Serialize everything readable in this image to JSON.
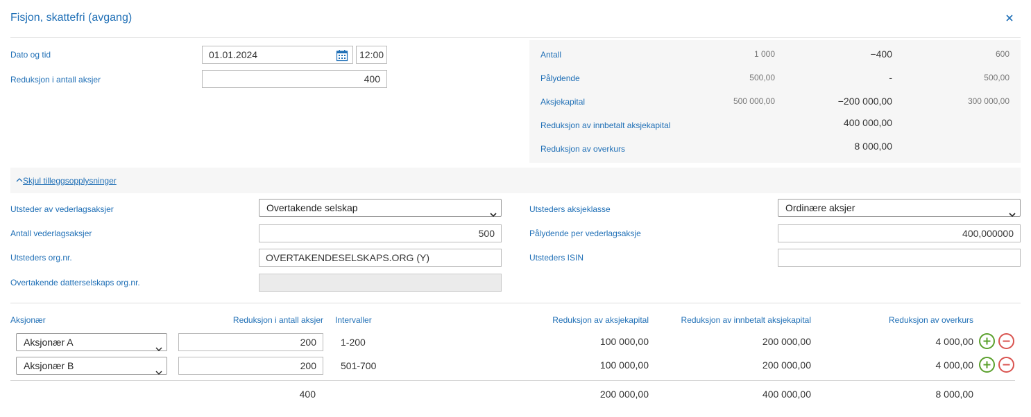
{
  "dialog": {
    "title": "Fisjon, skattefri (avgang)",
    "close_icon": "close-icon"
  },
  "form": {
    "date_label": "Dato og tid",
    "date_value": "01.01.2024",
    "time_value": "12:00",
    "reduction_label": "Reduksjon i antall aksjer",
    "reduction_value": "400"
  },
  "summary": {
    "rows": [
      {
        "label": "Antall",
        "before": "1 000",
        "change": "−400",
        "after": "600"
      },
      {
        "label": "Pålydende",
        "before": "500,00",
        "change": "-",
        "after": "500,00"
      },
      {
        "label": "Aksjekapital",
        "before": "500 000,00",
        "change": "−200 000,00",
        "after": "300 000,00"
      },
      {
        "label": "Reduksjon av innbetalt aksjekapital",
        "before": "",
        "change": "400 000,00",
        "after": ""
      },
      {
        "label": "Reduksjon av overkurs",
        "before": "",
        "change": "8 000,00",
        "after": ""
      }
    ]
  },
  "extra": {
    "toggle_label": "Skjul tilleggsopplysninger",
    "issuer_label": "Utsteder av vederlagsaksjer",
    "issuer_value": "Overtakende selskap",
    "count_label": "Antall vederlagsaksjer",
    "count_value": "500",
    "orgnr_label": "Utsteders org.nr.",
    "orgnr_value": "OVERTAKENDESELSKAPS.ORG (Y)",
    "sub_orgnr_label": "Overtakende datterselskaps org.nr.",
    "sub_orgnr_value": "",
    "class_label": "Utsteders aksjeklasse",
    "class_value": "Ordinære aksjer",
    "nominal_label": "Pålydende per vederlagsaksje",
    "nominal_value": "400,000000",
    "isin_label": "Utsteders ISIN",
    "isin_value": ""
  },
  "table": {
    "headers": {
      "shareholder": "Aksjonær",
      "reduction": "Reduksjon i antall aksjer",
      "intervals": "Intervaller",
      "capital": "Reduksjon av aksjekapital",
      "paid_in": "Reduksjon av innbetalt aksjekapital",
      "premium": "Reduksjon av overkurs"
    },
    "rows": [
      {
        "shareholder": "Aksjonær A",
        "reduction": "200",
        "intervals": "1-200",
        "capital": "100 000,00",
        "paid_in": "200 000,00",
        "premium": "4 000,00"
      },
      {
        "shareholder": "Aksjonær B",
        "reduction": "200",
        "intervals": "501-700",
        "capital": "100 000,00",
        "paid_in": "200 000,00",
        "premium": "4 000,00"
      }
    ],
    "totals": {
      "reduction": "400",
      "capital": "200 000,00",
      "paid_in": "400 000,00",
      "premium": "8 000,00"
    },
    "add_icon": "plus-circle-icon",
    "remove_icon": "minus-circle-icon"
  }
}
